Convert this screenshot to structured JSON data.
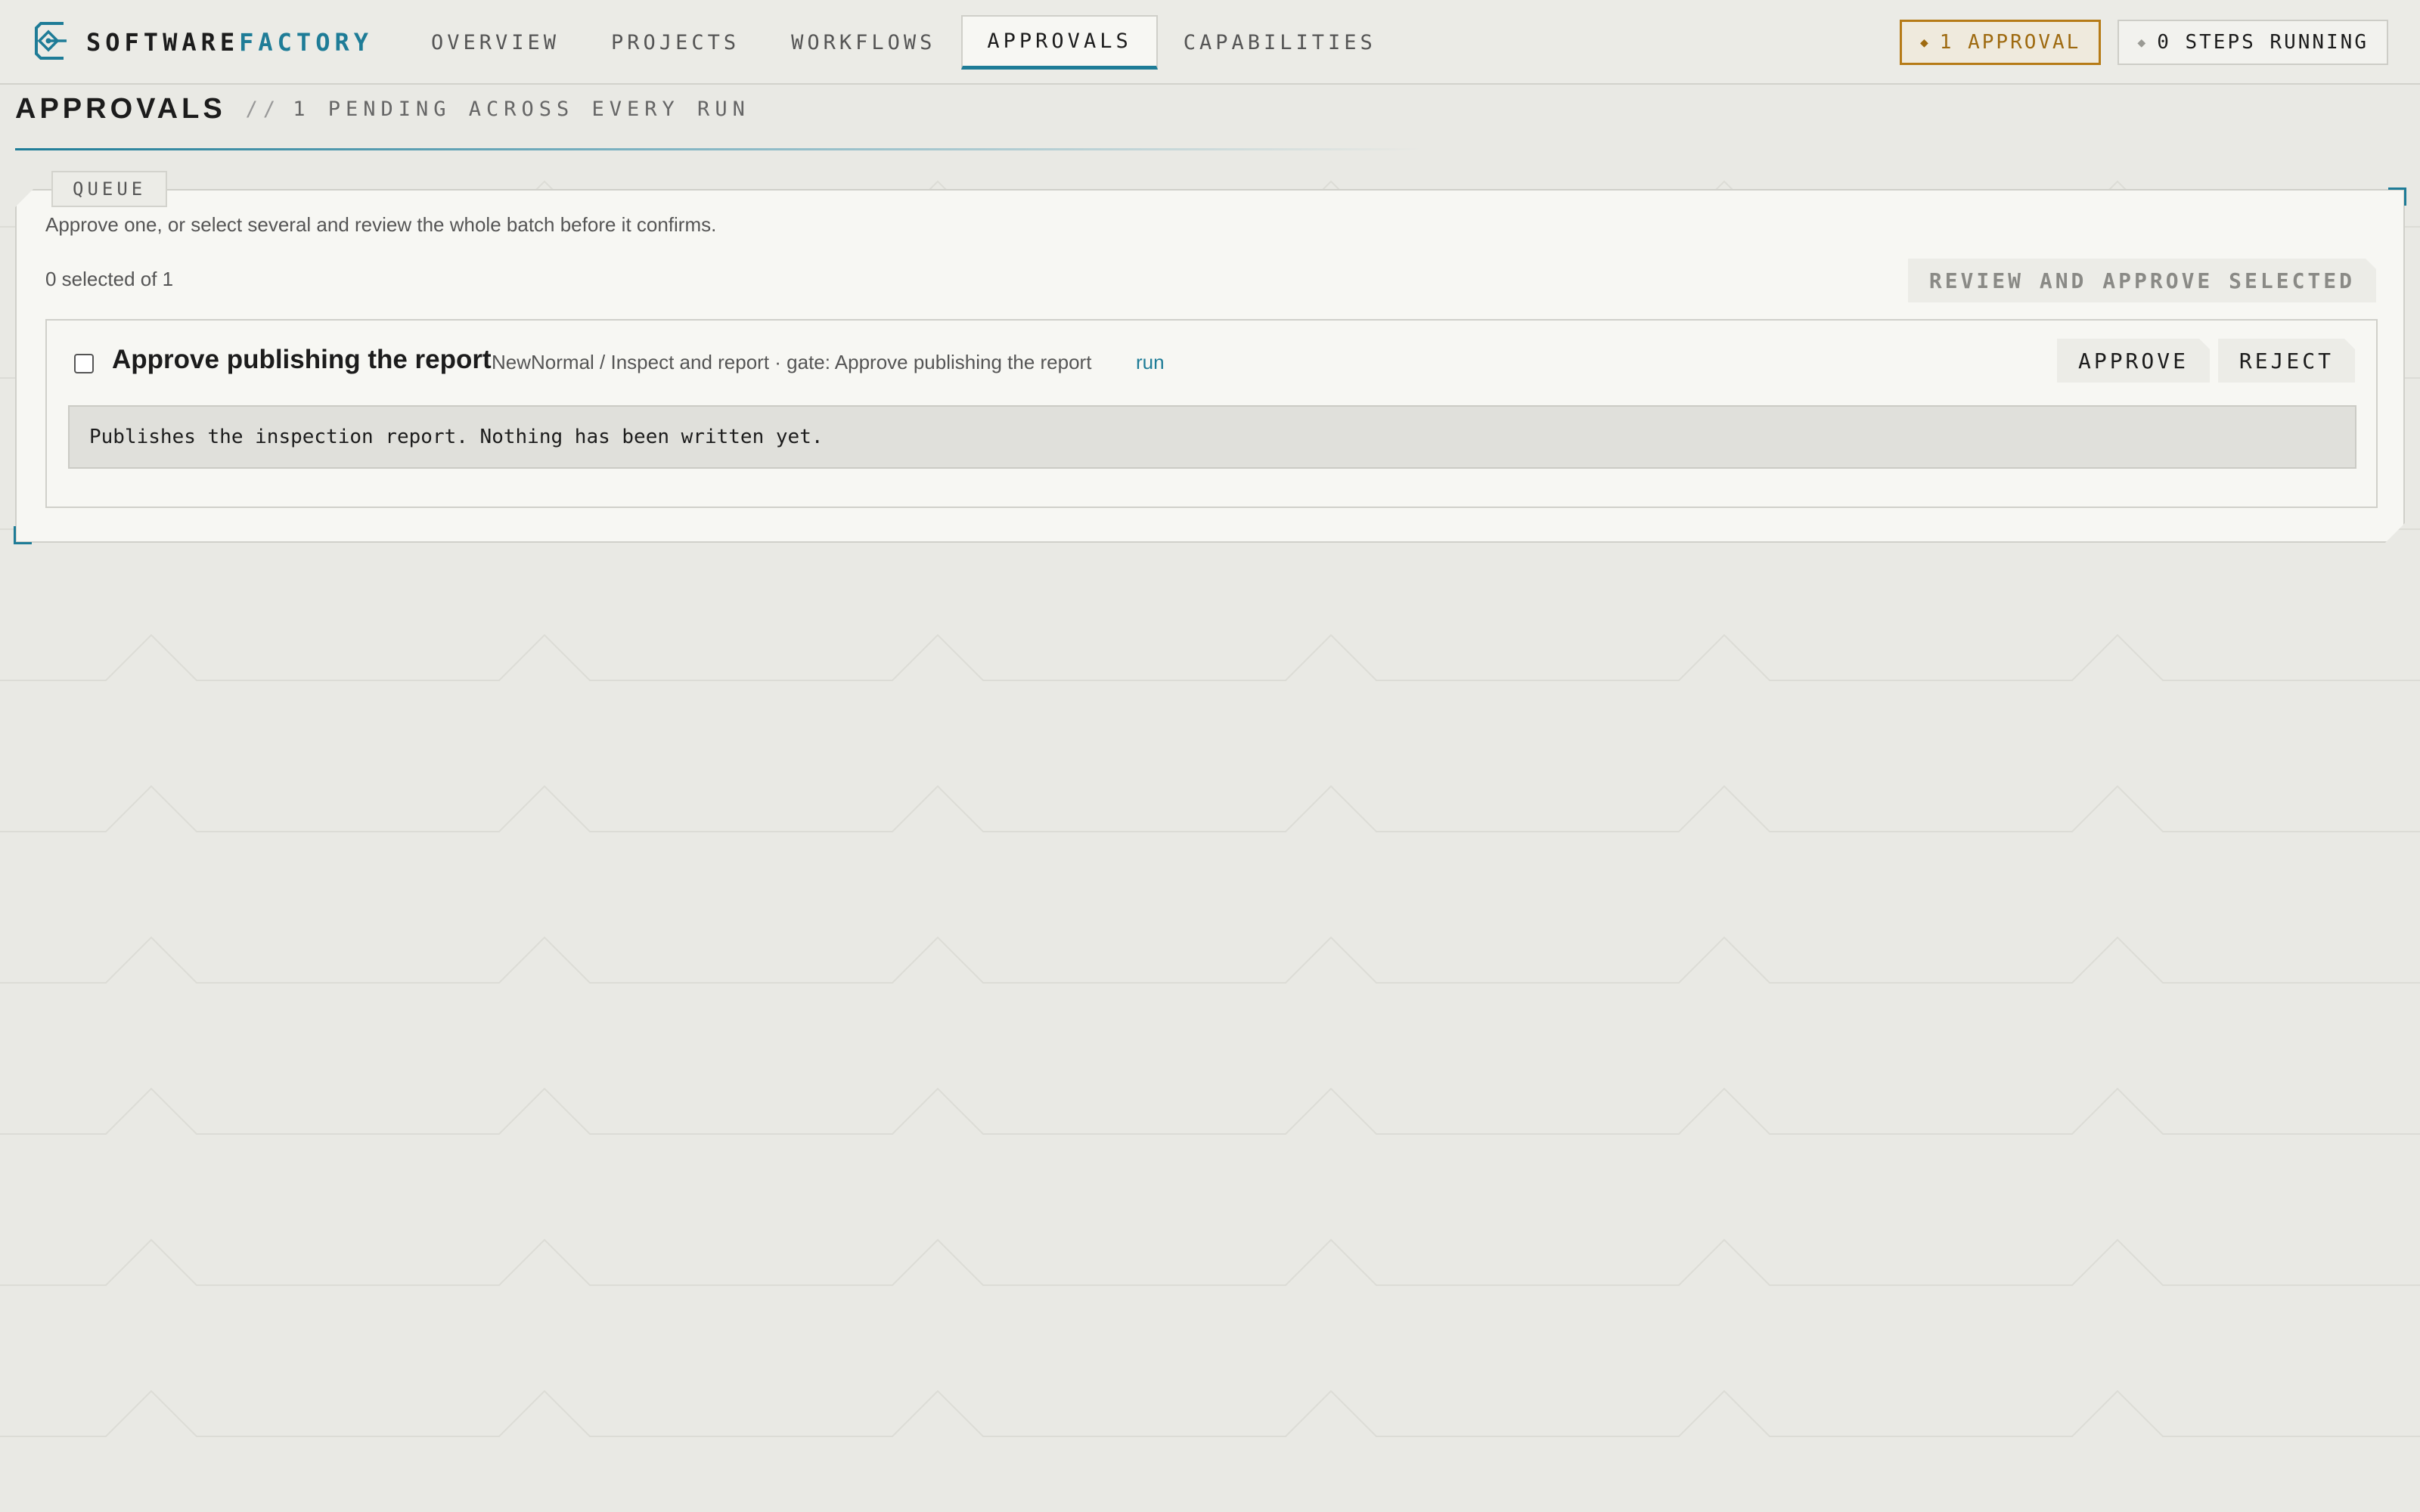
{
  "brand": {
    "name_part1": "SOFTWARE",
    "name_part2": "FACTORY",
    "logo_icon": "factory-logo-icon"
  },
  "nav": {
    "tabs": [
      {
        "label": "OVERVIEW",
        "active": false
      },
      {
        "label": "PROJECTS",
        "active": false
      },
      {
        "label": "WORKFLOWS",
        "active": false
      },
      {
        "label": "APPROVALS",
        "active": true
      },
      {
        "label": "CAPABILITIES",
        "active": false
      }
    ]
  },
  "status": {
    "approvals_badge": "1 APPROVAL",
    "steps_badge": "0 STEPS RUNNING"
  },
  "page": {
    "title": "APPROVALS",
    "subtitle_prefix": "//",
    "subtitle": "1 PENDING ACROSS EVERY RUN"
  },
  "queue": {
    "tag": "QUEUE",
    "description": "Approve one, or select several and review the whole batch before it confirms.",
    "selection_count": "0 selected of 1",
    "review_button": "REVIEW AND APPROVE SELECTED",
    "items": [
      {
        "checked": false,
        "title": "Approve publishing the report",
        "meta": "NewNormal / Inspect and report · gate: Approve publishing the report",
        "run_link": "run",
        "approve_label": "APPROVE",
        "reject_label": "REJECT",
        "note": "Publishes the inspection report. Nothing has been written yet."
      }
    ]
  },
  "colors": {
    "accent": "#1e7c97",
    "warning": "#b67b17",
    "background": "#e9e9e4",
    "panel": "#f7f7f3"
  }
}
